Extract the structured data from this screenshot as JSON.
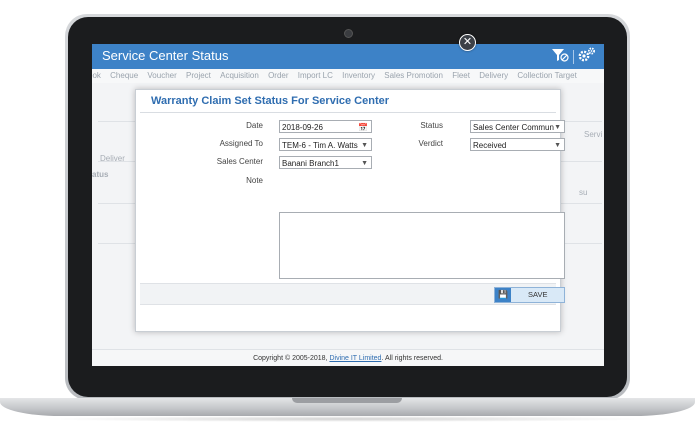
{
  "app": {
    "title": "Service Center Status",
    "icons": [
      "filter-off-icon",
      "settings-gears-icon"
    ]
  },
  "menu": {
    "items": [
      "ook",
      "Cheque",
      "Voucher",
      "Project",
      "Acquisition",
      "Order",
      "Import LC",
      "Inventory",
      "Sales Promotion",
      "Fleet",
      "Delivery",
      "Collection Target"
    ]
  },
  "background": {
    "serv_label": "Servi",
    "deliver_label": "Deliver",
    "status_label": "atus",
    "su_label": "su"
  },
  "modal": {
    "title": "Warranty Claim Set Status For Service Center",
    "fields": {
      "date_label": "Date",
      "date_value": "2018-09-26",
      "assigned_label": "Assigned To",
      "assigned_value": "TEM-6 - Tim A. Watts",
      "sales_center_label": "Sales Center",
      "sales_center_value": "Banani Branch1",
      "note_label": "Note",
      "status_label": "Status",
      "status_value": "Sales Center Commun",
      "verdict_label": "Verdict",
      "verdict_value": "Received"
    },
    "save_label": "SAVE"
  },
  "footer": {
    "prefix": "Copyright © 2005-2018,",
    "company": "Divine IT Limited",
    "suffix": ". All rights reserved."
  },
  "colors": {
    "header": "#3d82c7",
    "title_text": "#2f6db0",
    "save_bg": "#d9e9f7"
  }
}
